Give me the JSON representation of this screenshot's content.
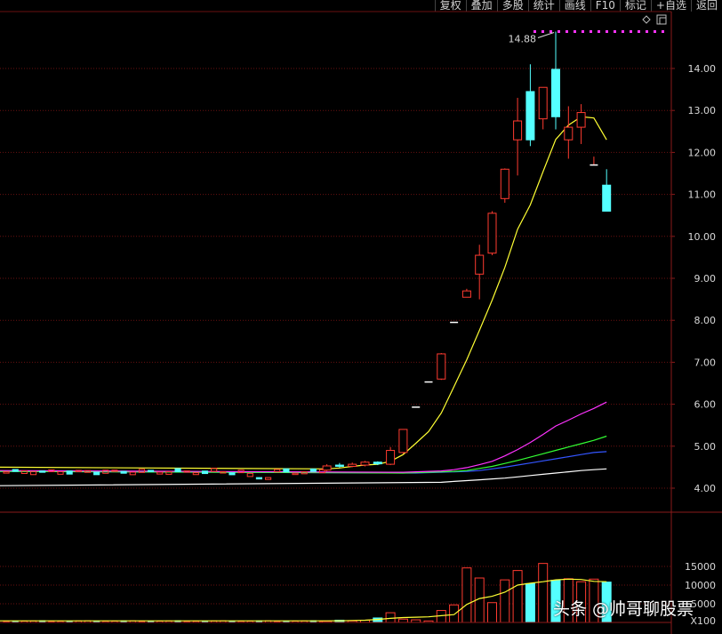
{
  "toolbar": {
    "items": [
      "复权",
      "叠加",
      "多股",
      "统计",
      "画线",
      "F10",
      "标记",
      "+自选",
      "返回"
    ]
  },
  "colors": {
    "up": "#ff3b30",
    "down": "#54ffff",
    "ma5": "#ffff33",
    "ma10": "#ff33ff",
    "ma20": "#33ff33",
    "ma30": "#3355ff",
    "ma60": "#ffffff",
    "grid": "#6a1010",
    "peak_marker": "#ff33ff"
  },
  "peak_label": "14.88",
  "watermark": "头条 @帅哥聊股票",
  "chart_data": [
    {
      "type": "candlestick",
      "y_ticks": [
        "14.00",
        "13.00",
        "12.00",
        "11.00",
        "10.00",
        "9.00",
        "8.00",
        "7.00",
        "6.00",
        "5.00",
        "4.00"
      ],
      "ylim": [
        3.9,
        15.1
      ],
      "flat_range": {
        "bars": 36,
        "base": 4.36
      },
      "candles": [
        {
          "o": 4.43,
          "c": 4.53,
          "h": 4.57,
          "l": 4.4
        },
        {
          "o": 4.55,
          "c": 4.52,
          "h": 4.6,
          "l": 4.49
        },
        {
          "o": 4.52,
          "c": 4.57,
          "h": 4.61,
          "l": 4.5
        },
        {
          "o": 4.55,
          "c": 4.62,
          "h": 4.65,
          "l": 4.52
        },
        {
          "o": 4.62,
          "c": 4.58,
          "h": 4.64,
          "l": 4.55
        },
        {
          "o": 4.57,
          "c": 4.9,
          "h": 4.98,
          "l": 4.55
        },
        {
          "o": 4.85,
          "c": 5.4,
          "h": 5.4,
          "l": 4.82
        },
        {
          "o": 5.93,
          "c": 5.93,
          "h": 5.93,
          "l": 5.93
        },
        {
          "o": 6.53,
          "c": 6.53,
          "h": 6.53,
          "l": 6.53
        },
        {
          "o": 6.6,
          "c": 7.2,
          "h": 7.22,
          "l": 6.58
        },
        {
          "o": 7.95,
          "c": 7.95,
          "h": 7.95,
          "l": 7.95
        },
        {
          "o": 8.55,
          "c": 8.7,
          "h": 8.75,
          "l": 8.55
        },
        {
          "o": 9.1,
          "c": 9.55,
          "h": 9.8,
          "l": 8.5
        },
        {
          "o": 9.6,
          "c": 10.55,
          "h": 10.6,
          "l": 9.55
        },
        {
          "o": 10.9,
          "c": 11.6,
          "h": 11.62,
          "l": 10.8
        },
        {
          "o": 12.3,
          "c": 12.75,
          "h": 13.3,
          "l": 11.45
        },
        {
          "o": 13.45,
          "c": 12.3,
          "h": 14.1,
          "l": 12.15
        },
        {
          "o": 12.8,
          "c": 13.55,
          "h": 13.55,
          "l": 12.55
        },
        {
          "o": 13.98,
          "c": 12.85,
          "h": 14.88,
          "l": 12.55
        },
        {
          "o": 12.3,
          "c": 12.6,
          "h": 13.1,
          "l": 11.85
        },
        {
          "o": 12.6,
          "c": 12.95,
          "h": 13.15,
          "l": 12.2
        },
        {
          "o": 11.7,
          "c": 11.7,
          "h": 11.9,
          "l": 11.7
        },
        {
          "o": 11.22,
          "c": 10.6,
          "h": 11.6,
          "l": 10.6
        }
      ],
      "ma5": [
        4.46,
        4.48,
        4.52,
        4.55,
        4.57,
        4.64,
        4.8,
        5.07,
        5.35,
        5.79,
        6.42,
        7.06,
        7.76,
        8.48,
        9.26,
        10.17,
        10.75,
        11.54,
        12.31,
        12.65,
        12.85,
        12.82,
        12.3
      ],
      "ma10": [
        4.38,
        4.38,
        4.39,
        4.4,
        4.41,
        4.44,
        4.49,
        4.56,
        4.64,
        4.77,
        4.92,
        5.09,
        5.28,
        5.48,
        5.62,
        5.77,
        5.9,
        6.05
      ],
      "ma20": [
        4.36,
        4.37,
        4.38,
        4.39,
        4.4,
        4.42,
        4.47,
        4.52,
        4.59,
        4.66,
        4.74,
        4.82,
        4.9,
        4.98,
        5.06,
        5.14,
        5.24
      ],
      "ma30": [
        4.36,
        4.37,
        4.38,
        4.39,
        4.4,
        4.42,
        4.46,
        4.5,
        4.55,
        4.6,
        4.65,
        4.7,
        4.75,
        4.8,
        4.85,
        4.87
      ],
      "ma60": [
        4.14,
        4.16,
        4.18,
        4.2,
        4.22,
        4.24,
        4.27,
        4.3,
        4.33,
        4.36,
        4.39,
        4.42,
        4.44,
        4.46
      ]
    },
    {
      "type": "bar",
      "y_ticks": [
        "15000",
        "10000",
        "5000"
      ],
      "ylim": [
        0,
        16000
      ],
      "unit_label": "X100",
      "flat_volume": 380,
      "volumes": [
        300,
        600,
        400,
        600,
        1200,
        2600,
        900,
        700,
        400,
        3200,
        4700,
        14600,
        11900,
        5300,
        11400,
        13900,
        10400,
        15800,
        11300,
        11700,
        10900,
        11600,
        10800
      ],
      "ma_line": [
        420,
        460,
        520,
        600,
        800,
        1100,
        1300,
        1400,
        1500,
        1800,
        2100,
        4800,
        6400,
        7000,
        8100,
        10000,
        10500,
        10900,
        11400,
        11600,
        11500,
        11000,
        10900
      ]
    }
  ]
}
